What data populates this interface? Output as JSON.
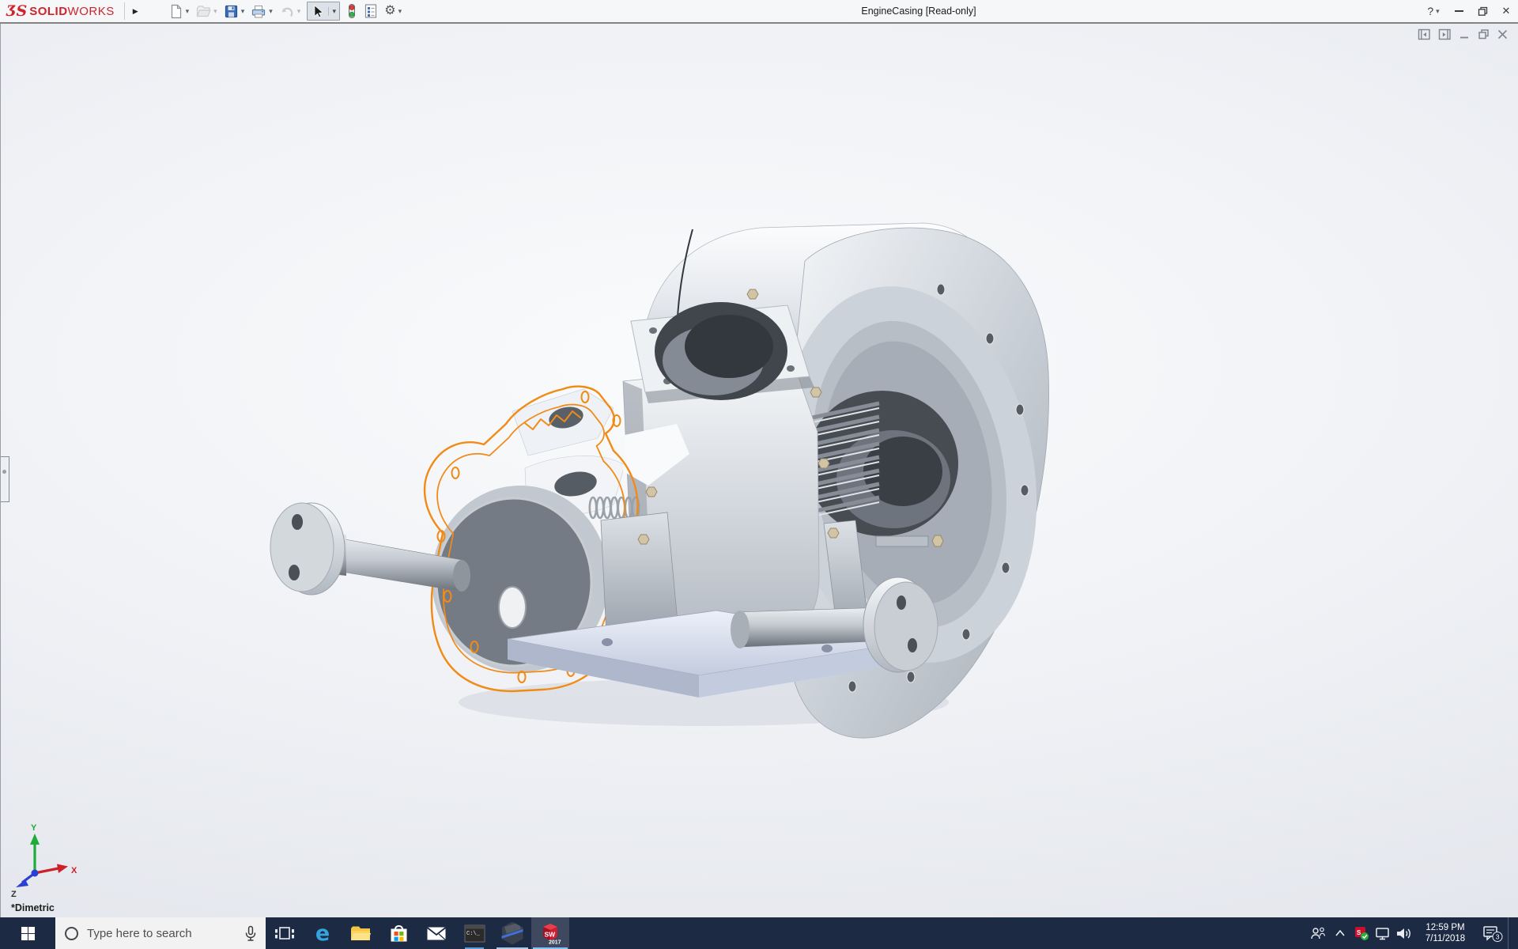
{
  "window": {
    "title": "EngineCasing [Read-only]"
  },
  "brand": {
    "logo_mark": "ƷS",
    "name_bold": "SOLID",
    "name_light": "WORKS",
    "brand_color": "#d0242c"
  },
  "glyphs": {
    "flyout_arrow": "▶",
    "dropdown_arrow": "▾",
    "gear": "⚙",
    "help": "?",
    "close": "✕"
  },
  "quick_access_toolbar": {
    "buttons": [
      "new-document",
      "open",
      "save",
      "print",
      "undo",
      "select",
      "rebuild",
      "file-properties",
      "options"
    ],
    "disabled_buttons": [
      "open",
      "undo"
    ],
    "active_button": "select"
  },
  "document_window_controls": [
    "collapse-left-pane",
    "collapse-right-pane",
    "minimize",
    "restore",
    "close"
  ],
  "viewport": {
    "view_orientation_label": "*Dimetric",
    "triad": {
      "x_label": "X",
      "y_label": "Y",
      "z_label": "Z"
    },
    "background_top_color": "#dcdfe7",
    "background_center_color": "#fafbfc",
    "selection_color": "#f28a16",
    "model_description": "EngineCasing assembly: silver cast engine crankcase with bell housing, cylinder bore flange, cooling fins, pedestal stand with base plate, two flanged axle shafts, and an orange highlighted cover-gasket outline (selected component)"
  },
  "taskbar": {
    "background_color": "#1d2a44",
    "search_placeholder": "Type here to search",
    "apps": [
      "start",
      "search",
      "task-view",
      "edge",
      "file-explorer",
      "store",
      "mail",
      "command-prompt",
      "hexagon-app",
      "solidworks-2017"
    ],
    "open_apps": [
      "command-prompt",
      "hexagon-app",
      "solidworks-2017"
    ],
    "active_app": "solidworks-2017",
    "edge_glyph": "e",
    "cmd_label": "C:\\_",
    "sw_label": "SW",
    "sw_year": "2017",
    "tray": {
      "time": "12:59 PM",
      "date": "7/11/2018",
      "notification_badge": "3"
    }
  }
}
